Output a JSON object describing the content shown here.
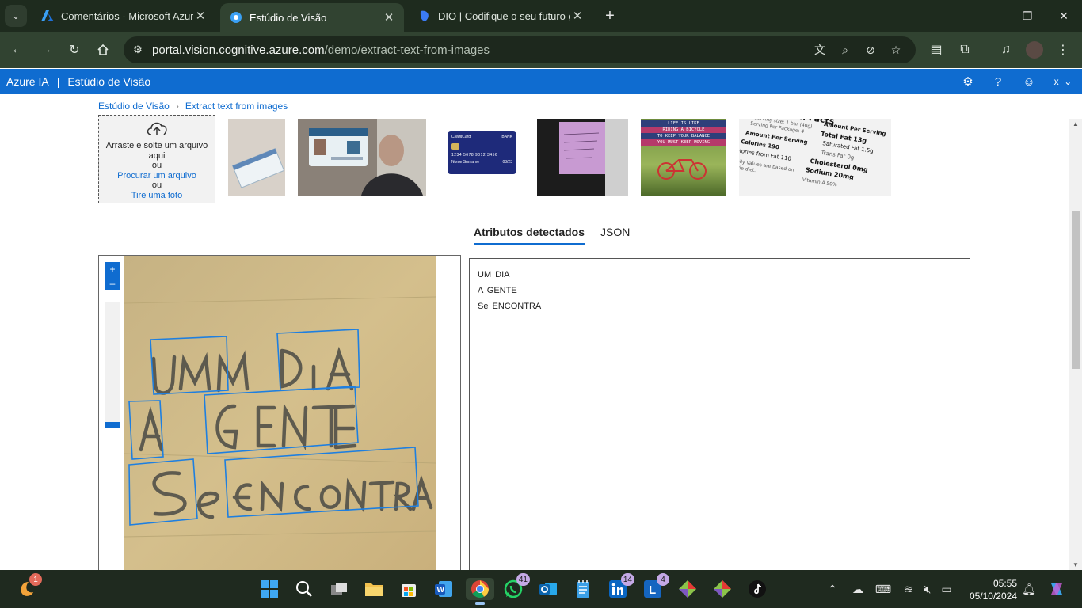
{
  "browser": {
    "tabs": [
      {
        "title": "Comentários - Microsoft Azure",
        "active": false
      },
      {
        "title": "Estúdio de Visão",
        "active": true
      },
      {
        "title": "DIO | Codifique o seu futuro glo",
        "active": false
      }
    ],
    "url_host": "portal.vision.cognitive.azure.com",
    "url_path": "/demo/extract-text-from-images"
  },
  "appbar": {
    "brand": "Azure IA",
    "separator": "|",
    "product": "Estúdio de Visão",
    "account_initial": "x"
  },
  "breadcrumb": {
    "root": "Estúdio de Visão",
    "current": "Extract text from images"
  },
  "dropzone": {
    "line1": "Arraste e solte um arquivo aqui",
    "or1": "ou",
    "browse": "Procurar um arquivo",
    "or2": "ou",
    "photo": "Tire uma foto"
  },
  "samples": {
    "nutrition_title": "Nutrition Facts",
    "nutrition_serving_size": "Serving size: 1 bar (40g)",
    "nutrition_servings": "Serving Per Package: 4",
    "nutrition_amount_left": "Amount Per Serving",
    "nutrition_calories": "Calories 190",
    "nutrition_fat_cal": "alories from Fat 110",
    "nutrition_daily": "Daily Values are based on",
    "nutrition_cal_diet": "alorie diet.",
    "nutrition_amount_right": "Amount Per Serving",
    "nutrition_total_fat": "Total Fat 13g",
    "nutrition_sat_fat": "Saturated Fat 1.5g",
    "nutrition_trans_fat": "Trans Fat 0g",
    "nutrition_cholesterol": "Cholesterol 0mg",
    "nutrition_sodium": "Sodium 20mg",
    "nutrition_vitamin": "Vitamin A 50%",
    "poster_line1": "LIFE IS LIKE",
    "poster_line2": "RIDING A BICYCLE",
    "poster_line3": "TO KEEP YOUR BALANCE",
    "poster_line4": "YOU MUST KEEP MOVING",
    "card_brand": "CreditCard",
    "card_bank": "BANK",
    "card_number": "1234 5678 9012 3456",
    "card_name": "Nome Surname",
    "card_expiry": "08/23"
  },
  "result_tabs": {
    "attributes": "Atributos detectados",
    "json": "JSON"
  },
  "zoom": {
    "in": "+",
    "out": "–"
  },
  "detected_lines": [
    "UM DIA",
    "A GENTE",
    "Se ENCONTRA"
  ],
  "taskbar": {
    "badges": {
      "weather": "1",
      "whatsapp": "41",
      "linkedin": "14",
      "lapp": "4"
    },
    "time": "05:55",
    "date": "05/10/2024"
  },
  "colors": {
    "azure_blue": "#0f6cd0",
    "chrome_dark": "#1e2b1e",
    "chrome_toolbar": "#314331",
    "box_blue": "#1e7fe0"
  }
}
